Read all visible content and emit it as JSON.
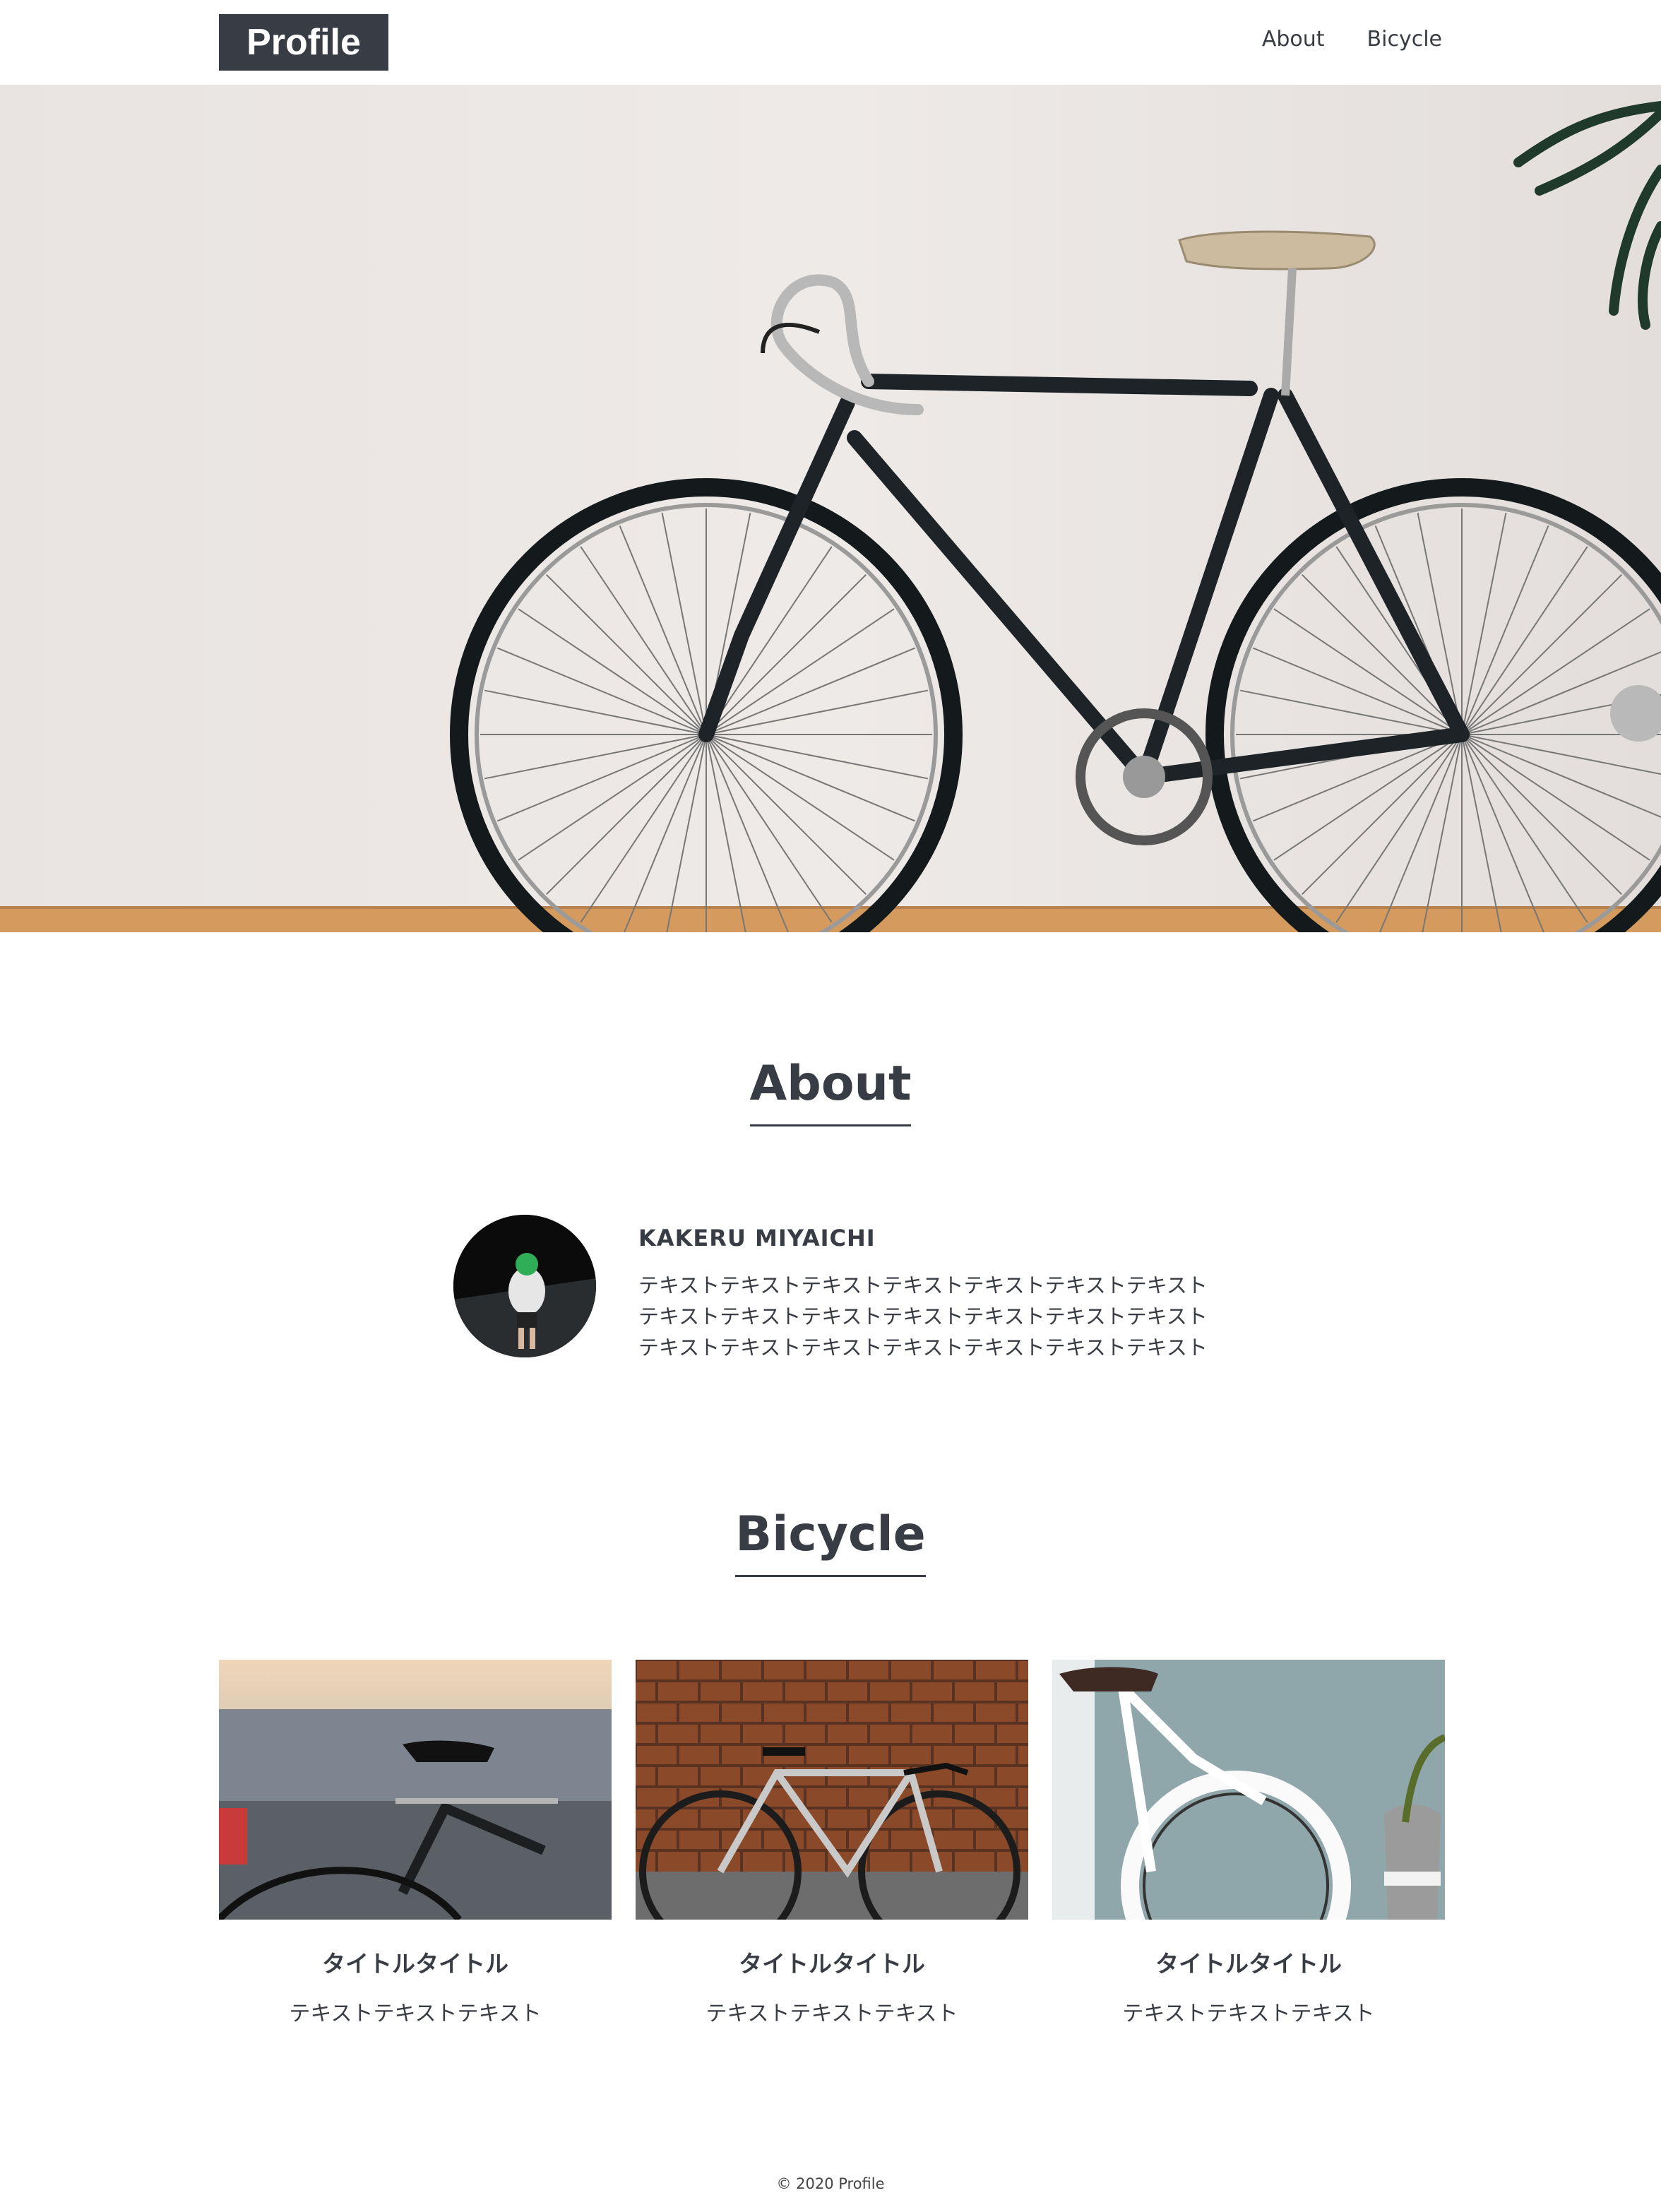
{
  "header": {
    "logo": "Profile",
    "nav": [
      "About",
      "Bicycle"
    ]
  },
  "about": {
    "heading": "About",
    "name": "KAKERU MIYAICHI",
    "lines": [
      "テキストテキストテキストテキストテキストテキストテキスト",
      "テキストテキストテキストテキストテキストテキストテキスト",
      "テキストテキストテキストテキストテキストテキストテキスト"
    ]
  },
  "bicycle": {
    "heading": "Bicycle",
    "cards": [
      {
        "title": "タイトルタイトル",
        "text": "テキストテキストテキスト"
      },
      {
        "title": "タイトルタイトル",
        "text": "テキストテキストテキスト"
      },
      {
        "title": "タイトルタイトル",
        "text": "テキストテキストテキスト"
      }
    ]
  },
  "footer": "© 2020 Profile"
}
